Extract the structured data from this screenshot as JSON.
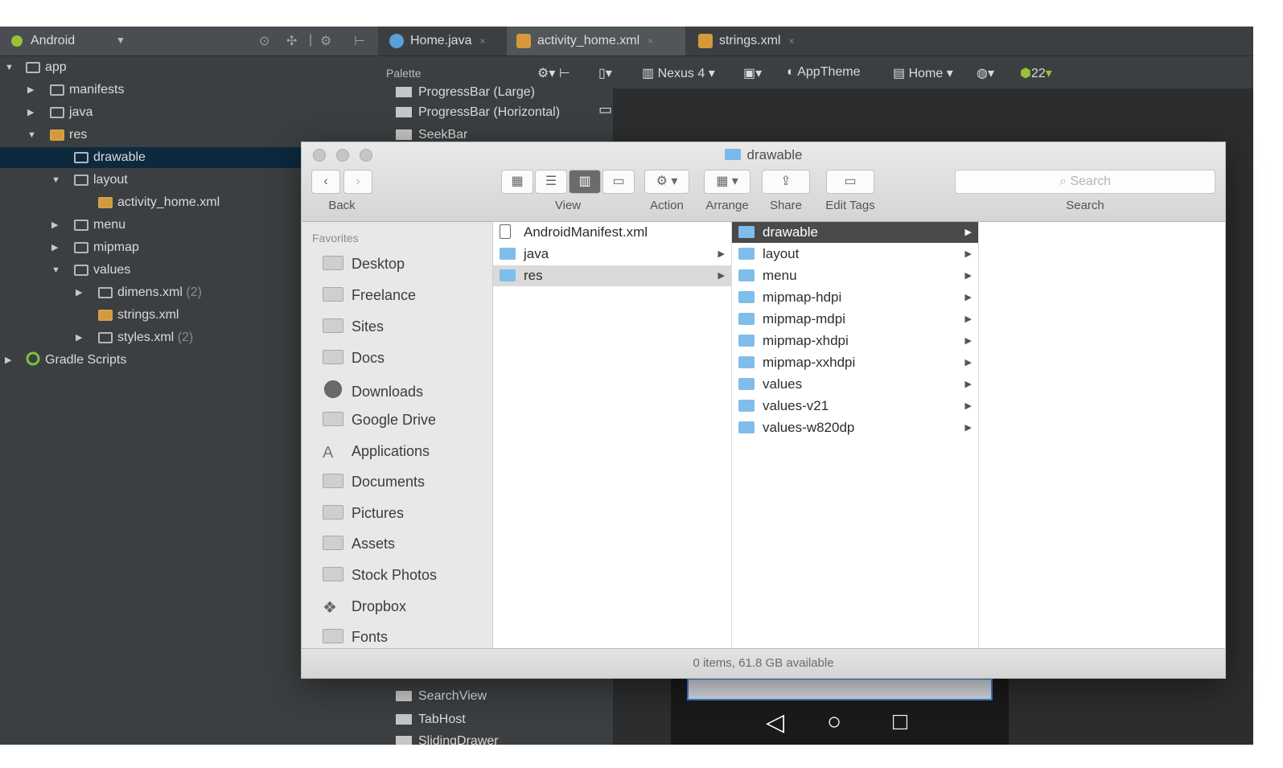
{
  "ide": {
    "project_selector": "Android",
    "tabs": [
      {
        "label": "Home.java"
      },
      {
        "label": "activity_home.xml"
      },
      {
        "label": "strings.xml"
      }
    ],
    "palette_label": "Palette",
    "design_toolbar": {
      "device": "Nexus 4",
      "theme": "AppTheme",
      "activity": "Home",
      "api": "22"
    },
    "tree": [
      {
        "label": "app"
      },
      {
        "label": "manifests"
      },
      {
        "label": "java"
      },
      {
        "label": "res"
      },
      {
        "label": "drawable"
      },
      {
        "label": "layout"
      },
      {
        "label": "activity_home.xml"
      },
      {
        "label": "menu"
      },
      {
        "label": "mipmap"
      },
      {
        "label": "values"
      },
      {
        "label": "dimens.xml",
        "count": "(2)"
      },
      {
        "label": "strings.xml"
      },
      {
        "label": "styles.xml",
        "count": "(2)"
      },
      {
        "label": "Gradle Scripts"
      }
    ],
    "palette_items": [
      {
        "label": "ProgressBar (Large)"
      },
      {
        "label": "ProgressBar (Horizontal)"
      },
      {
        "label": "SeekBar"
      },
      {
        "label": "SearchView"
      },
      {
        "label": "TabHost"
      },
      {
        "label": "SlidingDrawer"
      }
    ]
  },
  "finder": {
    "title": "drawable",
    "toolbar": {
      "back_label": "Back",
      "view_label": "View",
      "action_label": "Action",
      "arrange_label": "Arrange",
      "share_label": "Share",
      "edit_tags_label": "Edit Tags",
      "search_label": "Search",
      "search_placeholder": "Search"
    },
    "sidebar": {
      "heading": "Favorites",
      "items": [
        {
          "label": "Desktop"
        },
        {
          "label": "Freelance"
        },
        {
          "label": "Sites"
        },
        {
          "label": "Docs"
        },
        {
          "label": "Downloads"
        },
        {
          "label": "Google Drive"
        },
        {
          "label": "Applications"
        },
        {
          "label": "Documents"
        },
        {
          "label": "Pictures"
        },
        {
          "label": "Assets"
        },
        {
          "label": "Stock Photos"
        },
        {
          "label": "Dropbox"
        },
        {
          "label": "Fonts"
        }
      ]
    },
    "column1": [
      {
        "label": "AndroidManifest.xml"
      },
      {
        "label": "java"
      },
      {
        "label": "res"
      }
    ],
    "column2": [
      {
        "label": "drawable"
      },
      {
        "label": "layout"
      },
      {
        "label": "menu"
      },
      {
        "label": "mipmap-hdpi"
      },
      {
        "label": "mipmap-mdpi"
      },
      {
        "label": "mipmap-xhdpi"
      },
      {
        "label": "mipmap-xxhdpi"
      },
      {
        "label": "values"
      },
      {
        "label": "values-v21"
      },
      {
        "label": "values-w820dp"
      }
    ],
    "status": "0 items, 61.8 GB available"
  },
  "colors": {
    "ide_background": "#3c3f41",
    "ide_selection": "#0d293e",
    "finder_selection": "#4a4a4a",
    "folder_blue": "#7fbdea"
  }
}
